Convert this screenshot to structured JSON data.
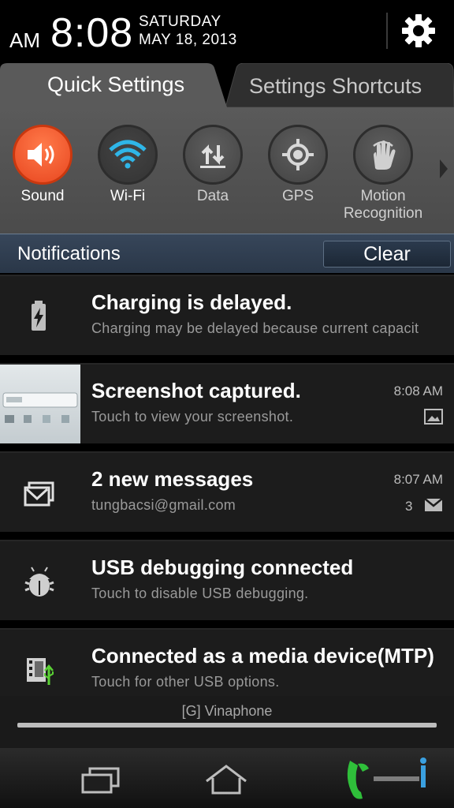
{
  "status": {
    "ampm": "AM",
    "time": "8:08",
    "day": "SATURDAY",
    "date": "MAY 18, 2013"
  },
  "tabs": {
    "quick": "Quick Settings",
    "shortcuts": "Settings Shortcuts"
  },
  "quick_settings": [
    {
      "label": "Sound",
      "icon": "sound-icon",
      "state": "on"
    },
    {
      "label": "Wi-Fi",
      "icon": "wifi-icon",
      "state": "on"
    },
    {
      "label": "Data",
      "icon": "data-icon",
      "state": "off"
    },
    {
      "label": "GPS",
      "icon": "gps-icon",
      "state": "off"
    },
    {
      "label": "Motion\nRecognition",
      "icon": "motion-icon",
      "state": "off"
    }
  ],
  "notifications_bar": {
    "title": "Notifications",
    "clear": "Clear"
  },
  "notifications": [
    {
      "title": "Charging is delayed.",
      "subtitle": "Charging may be delayed because current capacit",
      "time": "",
      "icon": "battery-icon"
    },
    {
      "title": "Screenshot captured.",
      "subtitle": "Touch to view your screenshot.",
      "time": "8:08 AM",
      "icon": "screenshot-thumbnail"
    },
    {
      "title": "2 new messages",
      "subtitle": "tungbacsi@gmail.com",
      "time": "8:07 AM",
      "count": "3",
      "icon": "mail-icon"
    },
    {
      "title": "USB debugging connected",
      "subtitle": "Touch to disable USB debugging.",
      "time": "",
      "icon": "android-debug-icon"
    },
    {
      "title": "Connected as a media device(MTP)",
      "subtitle": "Touch for other USB options.",
      "time": "",
      "icon": "usb-media-icon"
    }
  ],
  "carrier": "[G] Vinaphone",
  "colors": {
    "accent_on": "#e8461f",
    "wifi_blue": "#2fb6e8",
    "notif_bar": "#2a3748"
  }
}
